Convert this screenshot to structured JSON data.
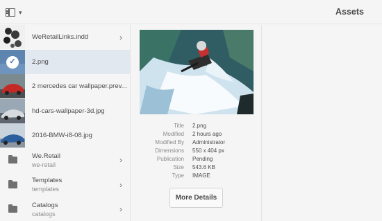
{
  "header": {
    "title": "Assets",
    "rail_toggle_icon": "side-panel-icon",
    "dropdown_icon": "chevron-down-icon"
  },
  "column1": {
    "items": [
      {
        "label": "WeRetailLinks.indd",
        "type": "asset",
        "has_children": true,
        "selected": false
      },
      {
        "label": "2.png",
        "type": "asset",
        "has_children": false,
        "selected": true
      },
      {
        "label": "2 mercedes car wallpaper.prev...",
        "type": "asset",
        "has_children": false,
        "selected": false
      },
      {
        "label": "hd-cars-wallpaper-3d.jpg",
        "type": "asset",
        "has_children": false,
        "selected": false
      },
      {
        "label": "2016-BMW-i8-08.jpg",
        "type": "asset",
        "has_children": false,
        "selected": false
      },
      {
        "label": "We.Retail",
        "sub": "we-retail",
        "type": "folder",
        "has_children": true,
        "selected": false
      },
      {
        "label": "Templates",
        "sub": "templates",
        "type": "folder",
        "has_children": true,
        "selected": false
      },
      {
        "label": "Catalogs",
        "sub": "catalogs",
        "type": "folder",
        "has_children": true,
        "selected": false
      }
    ]
  },
  "details": {
    "rows": [
      {
        "key": "Title",
        "value": "2.png"
      },
      {
        "key": "Modified",
        "value": "2 hours ago"
      },
      {
        "key": "Modified By",
        "value": "Administrator"
      },
      {
        "key": "Dimensions",
        "value": "550 x 404 px"
      },
      {
        "key": "Publication",
        "value": "Pending"
      },
      {
        "key": "Size",
        "value": "543.6 KB"
      },
      {
        "key": "Type",
        "value": "IMAGE"
      }
    ],
    "more_details_label": "More Details"
  },
  "colors": {
    "selected_row": "#e1e8f0",
    "background": "#f5f5f5"
  }
}
